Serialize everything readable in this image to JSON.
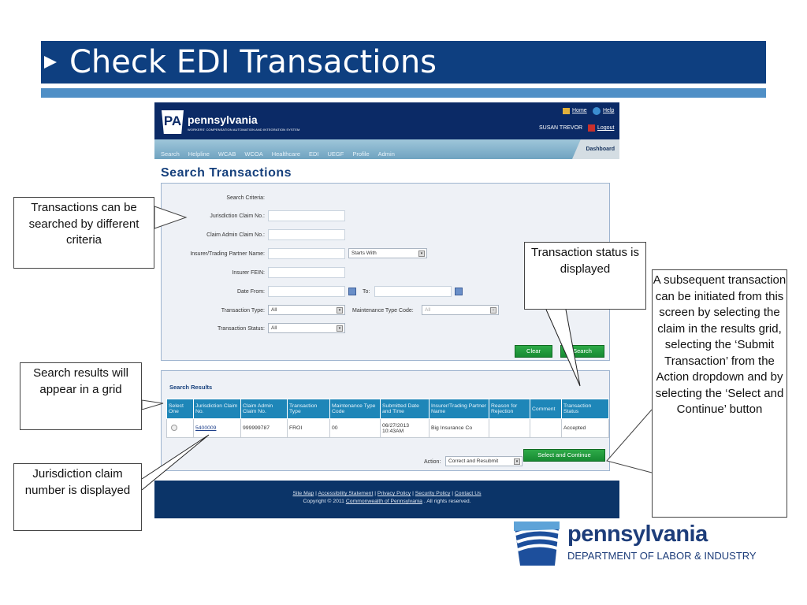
{
  "slide_title": "Check EDI Transactions",
  "app": {
    "brand": "pennsylvania",
    "brand_badge": "PA",
    "brand_subtitle": "WORKERS' COMPENSATION AUTOMATION AND INTEGRATION SYSTEM",
    "home": "Home",
    "help": "Help",
    "user": "SUSAN TREVOR",
    "logout": "Logout",
    "nav": [
      "Search",
      "Helpline",
      "WCAB",
      "WCOA",
      "Healthcare",
      "EDI",
      "UEGF",
      "Profile",
      "Admin"
    ],
    "dashboard": "Dashboard",
    "page_title": "Search Transactions",
    "form": {
      "criteria_label": "Search Criteria:",
      "jurisdiction_claim_no": "Jurisdiction Claim No.:",
      "claim_admin_claim_no": "Claim Admin Claim No.:",
      "insurer_name": "Insurer/Trading Partner Name:",
      "name_match": "Starts With",
      "insurer_fein": "Insurer FEIN:",
      "date_from": "Date From:",
      "date_to": "To:",
      "transaction_type": "Transaction Type:",
      "transaction_type_value": "All",
      "maintenance_type_code": "Maintenance Type Code:",
      "maintenance_type_value": "All",
      "transaction_status": "Transaction Status:",
      "transaction_status_value": "All",
      "clear": "Clear",
      "search": "Search"
    },
    "results": {
      "title": "Search Results",
      "columns": [
        "Select One",
        "Jurisdiction Claim No.",
        "Claim Admin Claim No.",
        "Transaction Type",
        "Maintenance Type Code",
        "Submitted Date and Time",
        "Insurer/Trading Partner Name",
        "Reason for Rejection",
        "Comment",
        "Transaction Status"
      ],
      "rows": [
        {
          "jurisdiction": "5400009",
          "claim_admin": "999999787",
          "type": "FROI",
          "maint": "00",
          "submitted": "06/27/2013 10:43AM",
          "insurer": "Big Insurance Co",
          "reason": "",
          "comment": "",
          "status": "Accepted"
        }
      ],
      "action_label": "Action:",
      "action_value": "Correct and Resubmit",
      "select_continue": "Select and Continue"
    },
    "footer": {
      "links": [
        "Site Map",
        "Accessibility Statement",
        "Privacy Policy",
        "Security Policy",
        "Contact Us"
      ],
      "copyright_pre": "Copyright © 2011",
      "copyright_link": "Commonwealth of Pennsylvania",
      "copyright_post": ". All rights reserved."
    }
  },
  "callouts": {
    "criteria": "Transactions can be searched by different criteria",
    "grid": "Search results will appear in a grid",
    "claim": "Jurisdiction claim number is displayed",
    "status": "Transaction status is displayed",
    "subsequent": "A subsequent transaction can be initiated from this screen by selecting the claim in the results grid, selecting the ‘Submit Transaction’ from the Action dropdown and by selecting the ‘Select and Continue’ button"
  },
  "logo": {
    "name": "pennsylvania",
    "dept": "DEPARTMENT OF LABOR & INDUSTRY"
  },
  "colors": {
    "title_bar": "#0e3f80",
    "stripe": "#4f8fc6",
    "app_header": "#0b2a66",
    "table_header": "#1e86b8",
    "button_green": "#1f9a3c"
  }
}
